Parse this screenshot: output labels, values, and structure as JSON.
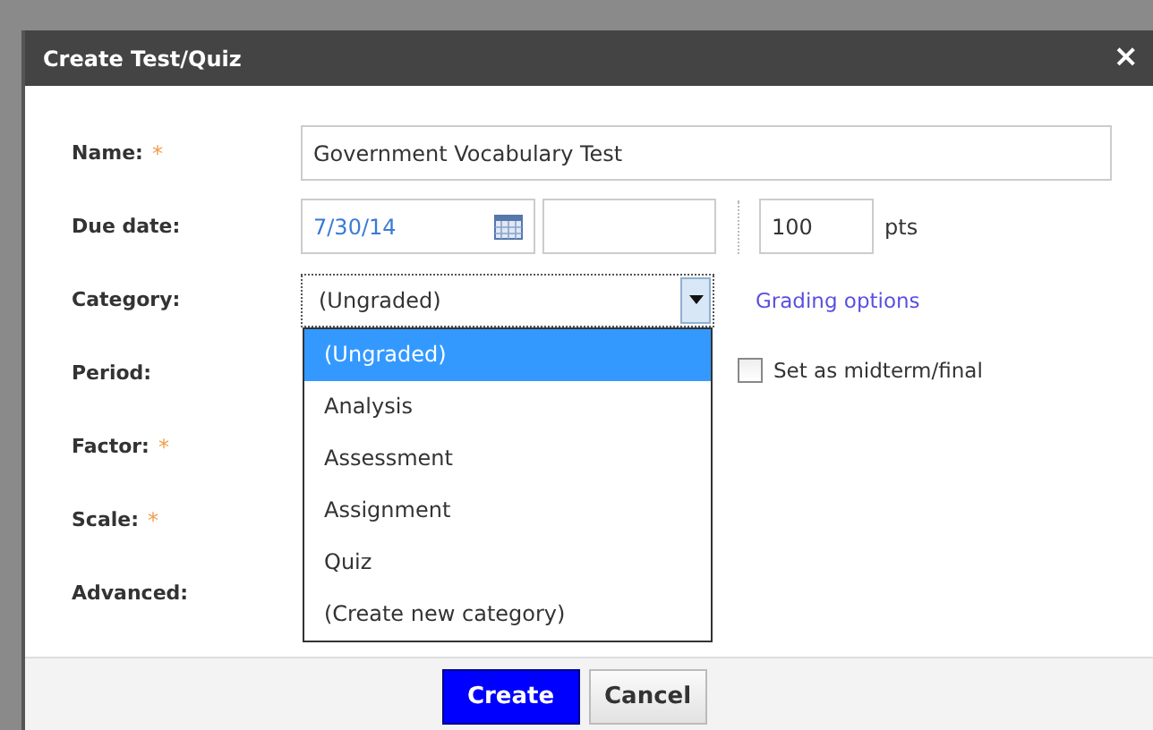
{
  "dialog": {
    "title": "Create Test/Quiz",
    "close": "×"
  },
  "name": {
    "label": "Name:",
    "required_mark": "*",
    "value": "Government Vocabulary Test"
  },
  "due_date": {
    "label": "Due date:",
    "date": "7/30/14",
    "points": "100",
    "points_unit": "pts"
  },
  "category": {
    "label": "Category:",
    "value": "(Ungraded)",
    "link": "Grading options",
    "expanded": true,
    "options": [
      {
        "label": "(Ungraded)",
        "selected": true
      },
      {
        "label": "Analysis",
        "selected": false
      },
      {
        "label": "Assessment",
        "selected": false
      },
      {
        "label": "Assignment",
        "selected": false
      },
      {
        "label": "Quiz",
        "selected": false
      },
      {
        "label": "(Create new category)",
        "selected": false
      }
    ]
  },
  "period": {
    "label": "Period:",
    "midterm": {
      "label": "Set as midterm/final",
      "checked": false
    }
  },
  "factor": {
    "label": "Factor:",
    "required_mark": "*"
  },
  "scale": {
    "label": "Scale:",
    "required_mark": "*"
  },
  "advanced": {
    "label": "Advanced:"
  },
  "buttons": [
    {
      "label": "Create",
      "kind": "primary"
    },
    {
      "label": "Cancel",
      "kind": "secondary"
    }
  ]
}
